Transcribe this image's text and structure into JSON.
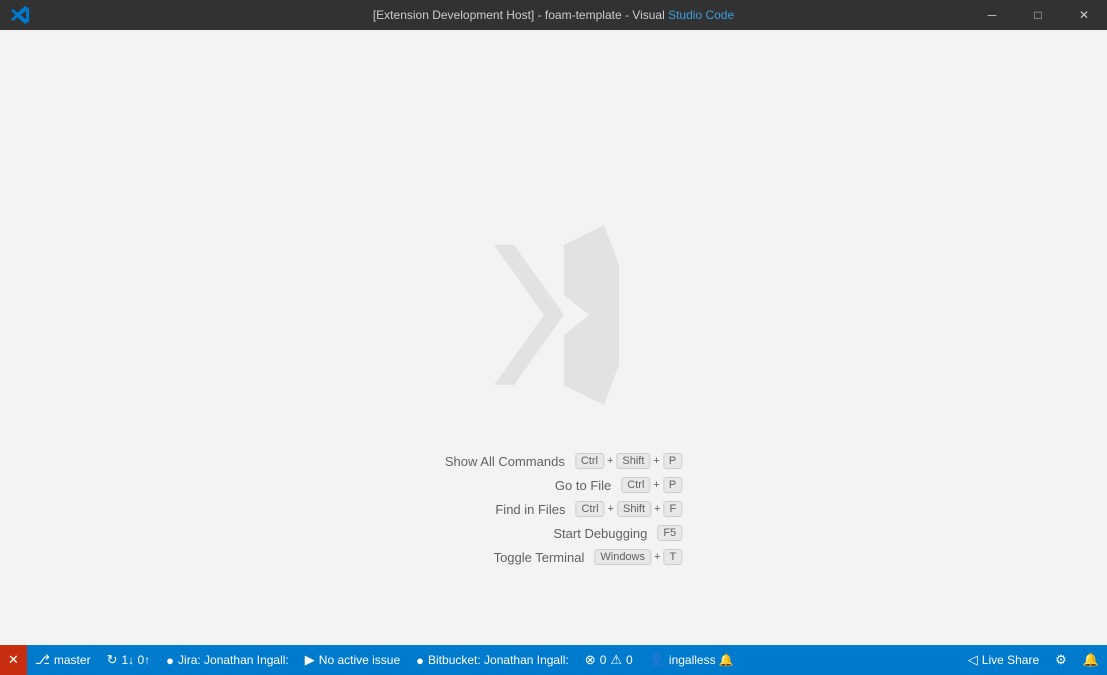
{
  "titleBar": {
    "title": "[Extension Development Host] - foam-template - Visual ",
    "titleHighlight": "Studio Code",
    "minimize": "─",
    "maximize": "□",
    "close": "✕"
  },
  "commands": [
    {
      "label": "Show All Commands",
      "keys": [
        "Ctrl",
        "+",
        "Shift",
        "+",
        "P"
      ]
    },
    {
      "label": "Go to File",
      "keys": [
        "Ctrl",
        "+",
        "P"
      ]
    },
    {
      "label": "Find in Files",
      "keys": [
        "Ctrl",
        "+",
        "Shift",
        "+",
        "F"
      ]
    },
    {
      "label": "Start Debugging",
      "keys": [
        "F5"
      ]
    },
    {
      "label": "Toggle Terminal",
      "keys": [
        "Windows",
        "+",
        "T"
      ]
    }
  ],
  "statusBar": {
    "leftItems": [
      {
        "id": "ext-host",
        "icon": "✕",
        "text": "",
        "errorBg": true
      },
      {
        "id": "git-branch",
        "icon": "⎇",
        "text": "master"
      },
      {
        "id": "git-sync",
        "icon": "↻",
        "text": "1↓ 0↑"
      },
      {
        "id": "jira",
        "icon": "●",
        "text": "Jira: Jonathan Ingall:"
      },
      {
        "id": "no-active-issue",
        "icon": "▶",
        "text": "No active issue"
      },
      {
        "id": "bitbucket",
        "icon": "●",
        "text": "Bitbucket: Jonathan Ingall:"
      },
      {
        "id": "errors",
        "icon": "⊗",
        "text": "0"
      },
      {
        "id": "warnings",
        "icon": "⚠",
        "text": "0"
      },
      {
        "id": "user",
        "icon": "",
        "text": "ingalless 🔔"
      }
    ],
    "rightItems": [
      {
        "id": "live-share",
        "icon": "◁",
        "text": "Live Share"
      },
      {
        "id": "remote",
        "icon": "⚙",
        "text": ""
      },
      {
        "id": "bell",
        "icon": "🔔",
        "text": ""
      }
    ]
  }
}
